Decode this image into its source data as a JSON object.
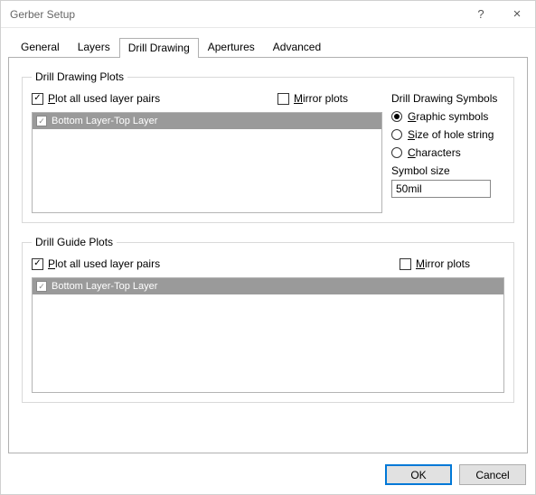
{
  "window": {
    "title": "Gerber Setup",
    "help_glyph": "?",
    "close_glyph": "×"
  },
  "tabs": [
    {
      "label": "General"
    },
    {
      "label": "Layers"
    },
    {
      "label": "Drill Drawing"
    },
    {
      "label": "Apertures"
    },
    {
      "label": "Advanced"
    }
  ],
  "active_tab_index": 2,
  "group_drawing": {
    "title": "Drill Drawing Plots",
    "plot_all_label_pre": "P",
    "plot_all_label_post": "lot all used layer pairs",
    "plot_all_checked": true,
    "mirror_label_pre": "M",
    "mirror_label_post": "irror plots",
    "mirror_checked": false,
    "layer_pairs": [
      "Bottom Layer-Top Layer"
    ],
    "symbols_title": "Drill Drawing Symbols",
    "radios": [
      {
        "pre": "G",
        "post": "raphic symbols"
      },
      {
        "pre": "S",
        "post": "ize of hole string"
      },
      {
        "pre": "C",
        "post": "haracters"
      }
    ],
    "radio_selected": 0,
    "symbol_size_label": "Symbol size",
    "symbol_size_value": "50mil"
  },
  "group_guide": {
    "title": "Drill Guide Plots",
    "plot_all_label_pre": "P",
    "plot_all_label_post": "lot all used layer pairs",
    "plot_all_checked": true,
    "mirror_label_pre": "M",
    "mirror_label_post": "irror plots",
    "mirror_checked": false,
    "layer_pairs": [
      "Bottom Layer-Top Layer"
    ]
  },
  "buttons": {
    "ok": "OK",
    "cancel": "Cancel"
  }
}
